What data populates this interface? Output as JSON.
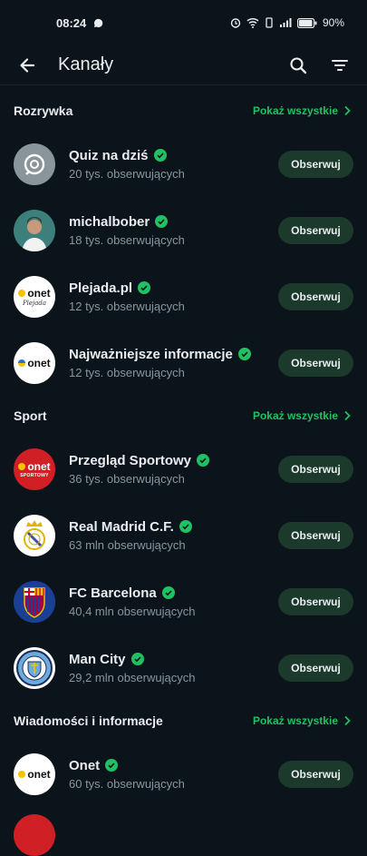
{
  "status": {
    "time": "08:24",
    "battery": "90%"
  },
  "header": {
    "title": "Kanały"
  },
  "sections": [
    {
      "title": "Rozrywka",
      "see_all": "Pokaż wszystkie",
      "channels": [
        {
          "name": "Quiz na dziś",
          "followers": "20 tys. obserwujących",
          "button": "Obserwuj"
        },
        {
          "name": "michalbober",
          "followers": "18 tys. obserwujących",
          "button": "Obserwuj"
        },
        {
          "name": "Plejada.pl",
          "followers": "12 tys. obserwujących",
          "button": "Obserwuj"
        },
        {
          "name": "Najważniejsze informacje",
          "followers": "12 tys. obserwujących",
          "button": "Obserwuj"
        }
      ]
    },
    {
      "title": "Sport",
      "see_all": "Pokaż wszystkie",
      "channels": [
        {
          "name": "Przegląd Sportowy",
          "followers": "36 tys. obserwujących",
          "button": "Obserwuj"
        },
        {
          "name": "Real Madrid C.F.",
          "followers": "63 mln obserwujących",
          "button": "Obserwuj"
        },
        {
          "name": "FC Barcelona",
          "followers": "40,4 mln obserwujących",
          "button": "Obserwuj"
        },
        {
          "name": "Man City",
          "followers": "29,2 mln obserwujących",
          "button": "Obserwuj"
        }
      ]
    },
    {
      "title": "Wiadomości i informacje",
      "see_all": "Pokaż wszystkie",
      "channels": [
        {
          "name": "Onet",
          "followers": "60 tys. obserwujących",
          "button": "Obserwuj"
        }
      ]
    }
  ],
  "logos": {
    "onet": "onet",
    "plejada_script": "Plejada",
    "sportowy_text": "SPORTOWY"
  },
  "colors": {
    "background": "#0b141a",
    "accent": "#21c063",
    "follow_bg": "#1b3a2c",
    "verified": "#21c063"
  }
}
